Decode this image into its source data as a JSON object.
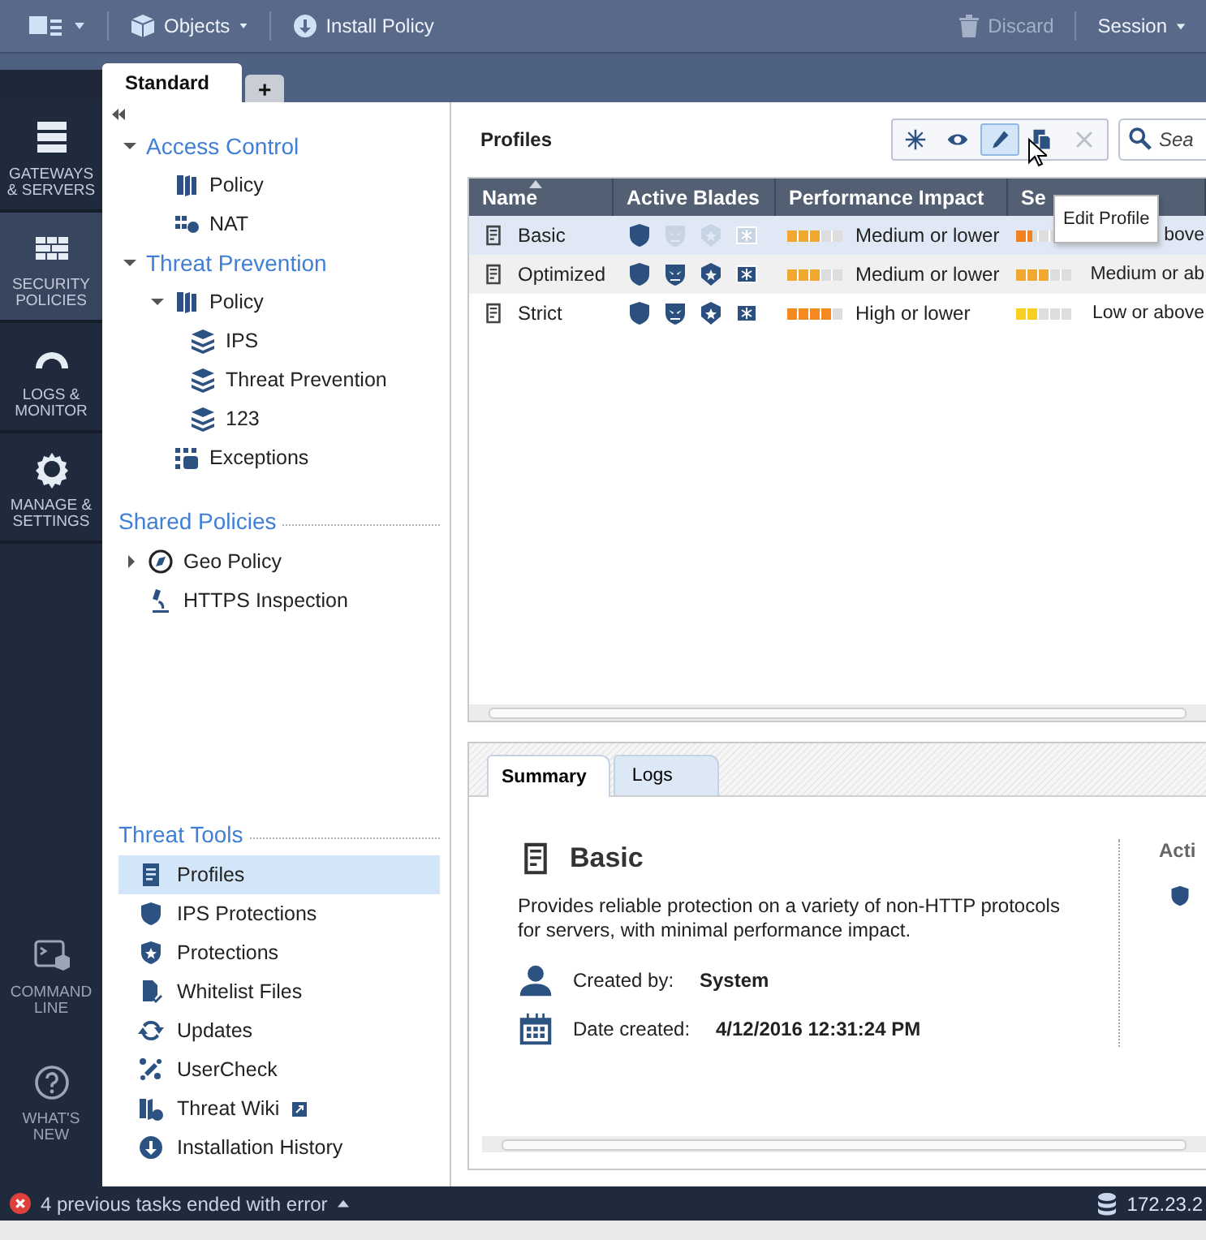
{
  "toolbar": {
    "objects": "Objects",
    "install": "Install Policy",
    "discard": {
      "label": "Discard",
      "disabled": true
    },
    "session": "Session"
  },
  "policy_tabs": [
    {
      "label": "Standard",
      "selected": true
    },
    {
      "label": "+",
      "selected": false
    }
  ],
  "nav": [
    {
      "kind": "gateways",
      "label": "GATEWAYS & SERVERS",
      "selected": false
    },
    {
      "kind": "security",
      "label": "SECURITY POLICIES",
      "selected": true
    },
    {
      "kind": "logs",
      "label": "LOGS & MONITOR",
      "selected": false
    },
    {
      "kind": "manage",
      "label": "MANAGE & SETTINGS",
      "selected": false
    }
  ],
  "nav_bottom": [
    {
      "kind": "command",
      "label": "COMMAND LINE"
    },
    {
      "kind": "whatsnew",
      "label": "WHAT'S NEW"
    }
  ],
  "tree": [
    {
      "title": "Access Control",
      "expanded": true,
      "items": [
        {
          "kind": "book",
          "label": "Policy"
        },
        {
          "kind": "nat",
          "label": "NAT"
        }
      ]
    },
    {
      "title": "Threat Prevention",
      "expanded": true,
      "items": [
        {
          "kind": "book",
          "label": "Policy",
          "expanded": true,
          "children": [
            {
              "kind": "layers",
              "label": "IPS"
            },
            {
              "kind": "layers",
              "label": "Threat Prevention"
            },
            {
              "kind": "layers",
              "label": "123"
            }
          ]
        },
        {
          "kind": "exceptions",
          "label": "Exceptions"
        }
      ]
    }
  ],
  "shared_policies": {
    "title": "Shared Policies",
    "items": [
      {
        "kind": "geo",
        "label": "Geo Policy",
        "expanded": false
      },
      {
        "kind": "https",
        "label": "HTTPS Inspection"
      }
    ]
  },
  "threat_tools": {
    "title": "Threat Tools",
    "items": [
      {
        "kind": "profile",
        "label": "Profiles",
        "selected": true
      },
      {
        "kind": "ips",
        "label": "IPS Protections",
        "selected": false
      },
      {
        "kind": "protections",
        "label": "Protections",
        "selected": false
      },
      {
        "kind": "whitelist",
        "label": "Whitelist Files",
        "selected": false
      },
      {
        "kind": "updates",
        "label": "Updates",
        "selected": false
      },
      {
        "kind": "usercheck",
        "label": "UserCheck",
        "selected": false
      },
      {
        "kind": "wiki",
        "label": "Threat Wiki",
        "selected": false,
        "external": true
      },
      {
        "kind": "install",
        "label": "Installation History",
        "selected": false
      }
    ]
  },
  "profiles": {
    "title": "Profiles",
    "actions": [
      {
        "kind": "new",
        "selected": false,
        "disabled": false
      },
      {
        "kind": "view",
        "selected": false,
        "disabled": false
      },
      {
        "kind": "edit",
        "selected": true,
        "disabled": false
      },
      {
        "kind": "clone",
        "selected": false,
        "disabled": false
      },
      {
        "kind": "delete",
        "selected": false,
        "disabled": true
      }
    ],
    "search_placeholder": "Sea",
    "tooltip": "Edit Profile",
    "columns": [
      "Name",
      "Active Blades",
      "Performance Impact",
      "Se"
    ],
    "rows": [
      {
        "name": "Basic",
        "selected": true,
        "blades": [
          true,
          false,
          false,
          false
        ],
        "performance": {
          "level": 0.6,
          "color": "#f0a830",
          "text": "Medium or lower"
        },
        "security": {
          "level": 0.3,
          "color": "#f08020",
          "text": "bove"
        }
      },
      {
        "name": "Optimized",
        "selected": false,
        "blades": [
          true,
          true,
          true,
          true
        ],
        "performance": {
          "level": 0.6,
          "color": "#f0a830",
          "text": "Medium or lower"
        },
        "security": {
          "level": 0.6,
          "color": "#f0a830",
          "text": "Medium or ab"
        }
      },
      {
        "name": "Strict",
        "selected": false,
        "blades": [
          true,
          true,
          true,
          true
        ],
        "performance": {
          "level": 0.8,
          "color": "#f58a20",
          "text": "High or lower"
        },
        "security": {
          "level": 0.4,
          "color": "#f5d020",
          "text": "Low or above"
        }
      }
    ]
  },
  "details": {
    "tabs": [
      {
        "label": "Summary",
        "selected": true
      },
      {
        "label": "Logs",
        "selected": false
      }
    ],
    "title": "Basic",
    "description": "Provides reliable protection on a variety of non-HTTP protocols for servers, with minimal performance impact.",
    "created_by_label": "Created by:",
    "created_by": "System",
    "date_label": "Date created:",
    "date": "4/12/2016 12:31:24 PM",
    "side_heading": "Acti"
  },
  "status_bar": {
    "message": "4 previous tasks ended with error",
    "server": "172.23.2"
  }
}
